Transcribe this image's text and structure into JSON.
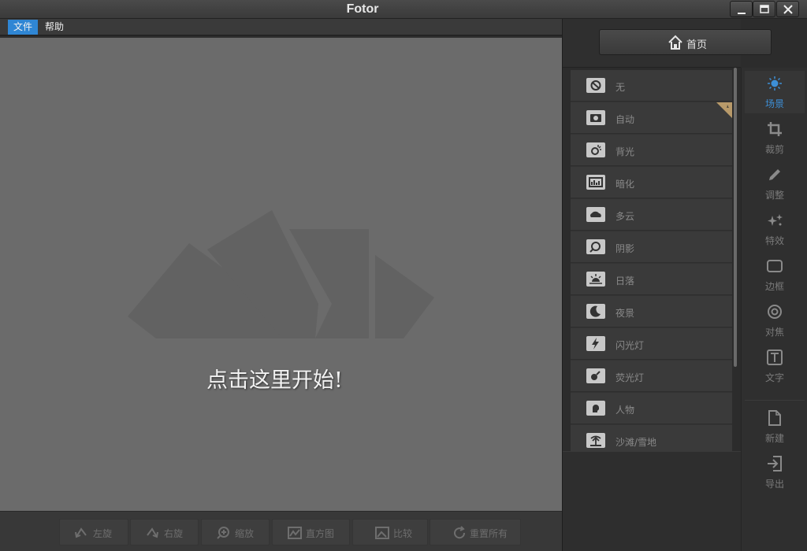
{
  "window": {
    "title": "Fotor",
    "minimize_icon": "minimize-icon",
    "maximize_icon": "maximize-icon",
    "close_icon": "close-icon"
  },
  "menu": {
    "file": "文件",
    "help": "帮助"
  },
  "canvas": {
    "start_text": "点击这里开始!"
  },
  "bottom_toolbar": {
    "rotate_left": "左旋",
    "rotate_right": "右旋",
    "zoom": "缩放",
    "histogram": "直方图",
    "compare": "比较",
    "reset_all": "重置所有"
  },
  "home_button": {
    "label": "首页",
    "icon": "home-icon"
  },
  "scenes": [
    {
      "label": "无",
      "icon": "none-icon"
    },
    {
      "label": "自动",
      "icon": "camera-icon"
    },
    {
      "label": "背光",
      "icon": "backlight-icon"
    },
    {
      "label": "暗化",
      "icon": "darken-icon"
    },
    {
      "label": "多云",
      "icon": "cloud-icon"
    },
    {
      "label": "阴影",
      "icon": "shadow-icon"
    },
    {
      "label": "日落",
      "icon": "sunset-icon"
    },
    {
      "label": "夜景",
      "icon": "moon-icon"
    },
    {
      "label": "闪光灯",
      "icon": "flash-icon"
    },
    {
      "label": "荧光灯",
      "icon": "fluorescent-icon"
    },
    {
      "label": "人物",
      "icon": "portrait-icon"
    },
    {
      "label": "沙滩/雪地",
      "icon": "beach-icon"
    }
  ],
  "sidenav": [
    {
      "label": "场景",
      "icon": "sun-icon",
      "active": true
    },
    {
      "label": "裁剪",
      "icon": "crop-icon"
    },
    {
      "label": "调整",
      "icon": "pencil-icon"
    },
    {
      "label": "特效",
      "icon": "sparkle-icon"
    },
    {
      "label": "边框",
      "icon": "frame-icon"
    },
    {
      "label": "对焦",
      "icon": "focus-icon"
    },
    {
      "label": "文字",
      "icon": "text-icon"
    },
    {
      "label": "新建",
      "icon": "new-file-icon"
    },
    {
      "label": "导出",
      "icon": "export-icon"
    }
  ],
  "colors": {
    "accent": "#2f86d4",
    "active_nav": "#3d8fd6",
    "canvas": "#6b6b6b"
  }
}
